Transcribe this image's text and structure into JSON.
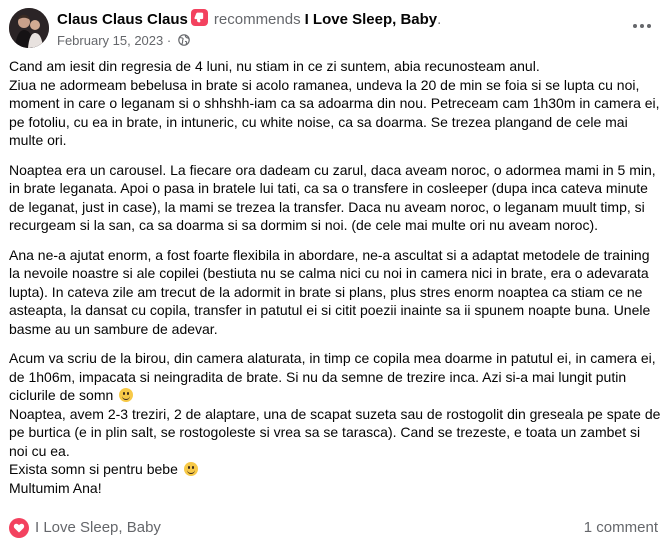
{
  "header": {
    "author": "Claus Claus Claus",
    "verb": "recommends",
    "page": "I Love Sleep, Baby",
    "punct": ".",
    "date": "February 15, 2023",
    "separator": "·"
  },
  "body": {
    "paragraphs": [
      {
        "lines": [
          "Cand am iesit din regresia de 4 luni, nu stiam in ce zi suntem, abia recunosteam anul.",
          "Ziua ne adormeam bebelusa in brate si acolo ramanea, undeva la 20 de min se foia si se lupta cu noi, moment in care o leganam si o shhshh-iam ca sa adoarma din nou. Petreceam cam 1h30m in camera ei, pe fotoliu, cu ea in brate, in intuneric, cu white noise, ca sa doarma. Se trezea plangand de cele mai multe ori."
        ]
      },
      {
        "lines": [
          "Noaptea era un carousel. La fiecare ora dadeam cu zarul, daca aveam noroc, o adormea mami in 5 min, in brate leganata. Apoi o pasa in bratele lui tati, ca sa o transfere in cosleeper (dupa inca cateva minute de leganat, just in case), la mami se trezea la transfer. Daca nu aveam noroc, o leganam muult timp, si recurgeam si la san, ca sa doarma si sa dormim si noi. (de cele mai multe ori nu aveam noroc)."
        ]
      },
      {
        "lines": [
          "Ana ne-a ajutat enorm, a fost foarte flexibila in abordare, ne-a ascultat si a adaptat metodele de training la nevoile noastre si ale copilei (bestiuta nu se calma nici cu noi in camera nici in brate, era o adevarata lupta). In cateva zile am trecut de la adormit in brate si plans, plus stres enorm noaptea ca stiam ce ne asteapta, la dansat cu copila, transfer in patutul ei si citit poezii inainte sa ii spunem noapte buna. Unele basme au un sambure de adevar."
        ]
      }
    ],
    "last": {
      "l1": "Acum va scriu de la birou, din camera alaturata, in timp ce copila mea doarme in patutul ei, in camera ei, de 1h06m, impacata si neingradita de brate. Si nu da semne de trezire inca. Azi si-a mai lungit putin ciclurile de somn",
      "l2": "Noaptea, avem 2-3 treziri, 2 de alaptare, una de scapat suzeta sau de rostogolit din greseala pe spate de pe burtica (e in plin salt, se rostogoleste si vrea sa se tarasca). Cand se trezeste, e toata un zambet si noi cu ea.",
      "l3": " Exista somn si pentru bebe",
      "l4": "Multumim Ana!"
    }
  },
  "footer": {
    "page": "I Love Sleep, Baby",
    "comments": "1 comment"
  },
  "colors": {
    "accent": "#f3425f",
    "secondary_text": "#65676b",
    "text": "#050505"
  },
  "icons": [
    "recommend-badge-icon",
    "globe-icon",
    "more-options-icon",
    "heart-icon",
    "smile-emoji-icon"
  ]
}
